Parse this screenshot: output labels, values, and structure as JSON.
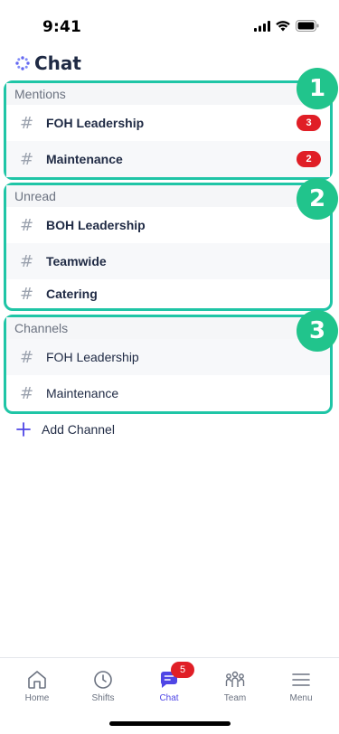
{
  "status_bar": {
    "time": "9:41"
  },
  "header": {
    "title": "Chat",
    "logo_icon": "sparkle-logo-icon"
  },
  "sections": [
    {
      "title": "Mentions",
      "step": "1",
      "rows": [
        {
          "label": "FOH Leadership",
          "badge": "3"
        },
        {
          "label": "Maintenance",
          "badge": "2"
        }
      ]
    },
    {
      "title": "Unread",
      "step": "2",
      "rows": [
        {
          "label": "BOH Leadership"
        },
        {
          "label": "Teamwide"
        },
        {
          "label": "Catering"
        }
      ]
    },
    {
      "title": "Channels",
      "step": "3",
      "rows": [
        {
          "label": "FOH Leadership"
        },
        {
          "label": "Maintenance"
        }
      ]
    }
  ],
  "hash_symbol": "#",
  "add_channel": {
    "label": "Add Channel"
  },
  "tab_bar": {
    "tabs": [
      {
        "label": "Home",
        "icon": "home-icon"
      },
      {
        "label": "Shifts",
        "icon": "clock-icon"
      },
      {
        "label": "Chat",
        "icon": "chat-icon",
        "badge": "5",
        "active": true
      },
      {
        "label": "Team",
        "icon": "team-icon"
      },
      {
        "label": "Menu",
        "icon": "menu-icon"
      }
    ]
  },
  "colors": {
    "accent": "#4f46e5",
    "highlight_border": "#1fc5a6",
    "step_badge": "#21c48c",
    "badge_red": "#e01e26"
  }
}
